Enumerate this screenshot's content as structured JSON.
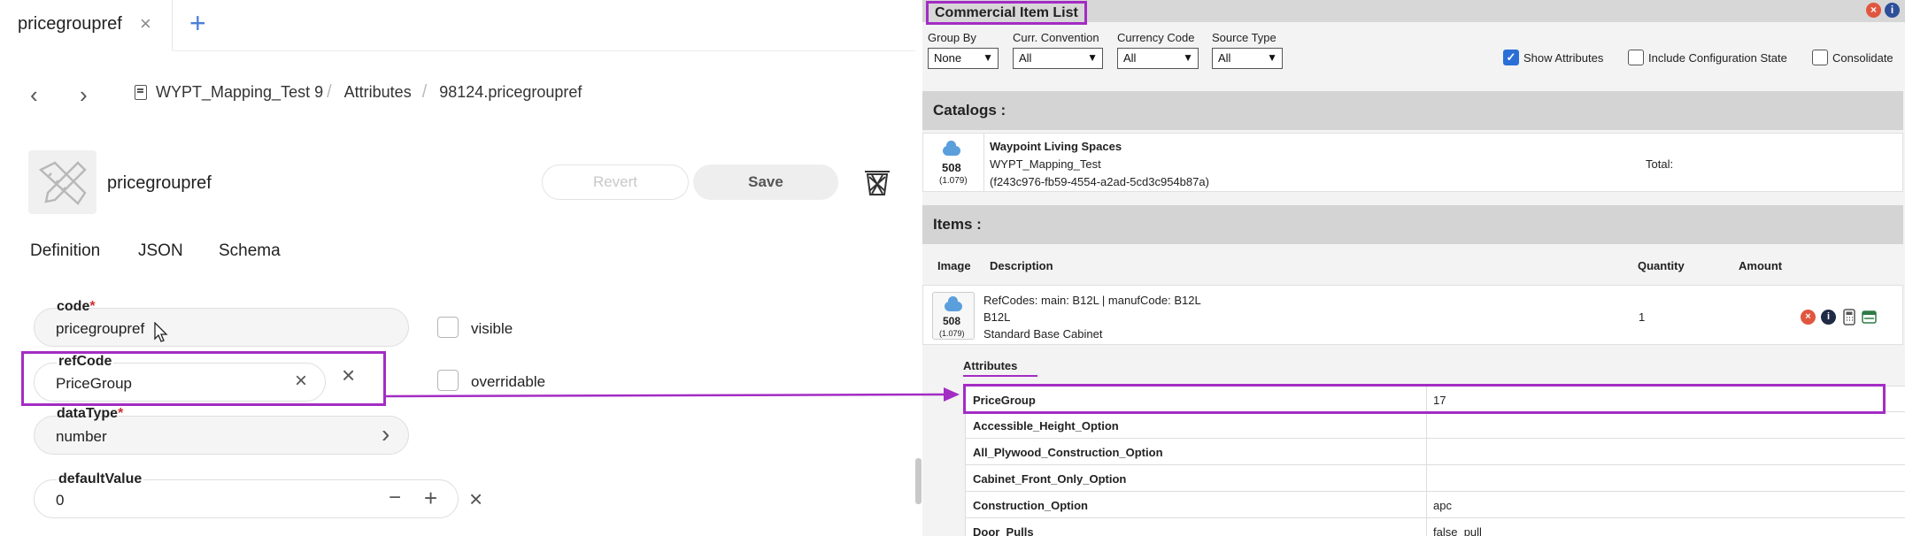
{
  "left": {
    "tab": {
      "label": "pricegroupref",
      "close": "×"
    },
    "tab_add": "+",
    "nav": {
      "back": "‹",
      "forward": "›"
    },
    "breadcrumb": [
      {
        "label": "WYPT_Mapping_Test 9"
      },
      {
        "label": "Attributes"
      },
      {
        "label": "98124.pricegroupref"
      }
    ],
    "breadcrumb_sep": "/",
    "resource_title": "pricegroupref",
    "buttons": {
      "revert": "Revert",
      "save": "Save"
    },
    "subtabs": [
      "Definition",
      "JSON",
      "Schema"
    ],
    "fields": {
      "code": {
        "label": "code",
        "required": "*",
        "value": "pricegroupref"
      },
      "refCode": {
        "label": "refCode",
        "value": "PriceGroup"
      },
      "dataType": {
        "label": "dataType",
        "required": "*",
        "value": "number"
      },
      "defaultValue": {
        "label": "defaultValue",
        "value": "0"
      }
    },
    "checkboxes": {
      "visible": "visible",
      "overridable": "overridable"
    },
    "icons": {
      "clear": "×",
      "chevron": "›",
      "minus": "−",
      "plus": "+"
    }
  },
  "right": {
    "title": "Commercial Item List",
    "filters": [
      {
        "label": "Group By",
        "value": "None"
      },
      {
        "label": "Curr. Convention",
        "value": "All"
      },
      {
        "label": "Currency Code",
        "value": "All"
      },
      {
        "label": "Source Type",
        "value": "All"
      }
    ],
    "options": [
      {
        "label": "Show Attributes",
        "checked": true
      },
      {
        "label": "Include Configuration State",
        "checked": false
      },
      {
        "label": "Consolidate",
        "checked": false
      }
    ],
    "catalogs_label": "Catalogs :",
    "catalog": {
      "count": "508",
      "sub_count": "(1.079)",
      "name": "Waypoint Living Spaces",
      "code": "WYPT_Mapping_Test",
      "guid": "(f243c976-fb59-4554-a2ad-5cd3c954b87a)",
      "total_label": "Total:"
    },
    "items_label": "Items :",
    "columns": {
      "image": "Image",
      "description": "Description",
      "quantity": "Quantity",
      "amount": "Amount"
    },
    "item": {
      "count": "508",
      "sub_count": "(1.079)",
      "refcodes": "RefCodes: main: B12L | manufCode: B12L",
      "code": "B12L",
      "name": "Standard Base Cabinet",
      "quantity": "1"
    },
    "attributes_label": "Attributes",
    "attributes": [
      {
        "name": "PriceGroup",
        "value": "17"
      },
      {
        "name": "Accessible_Height_Option",
        "value": ""
      },
      {
        "name": "All_Plywood_Construction_Option",
        "value": ""
      },
      {
        "name": "Cabinet_Front_Only_Option",
        "value": ""
      },
      {
        "name": "Construction_Option",
        "value": "apc"
      },
      {
        "name": "Door_Pulls",
        "value": "false_pull"
      }
    ]
  },
  "colors": {
    "highlight": "#a32cc4",
    "accent": "#2a6fd6",
    "danger": "#e0563f",
    "cloud": "#5a9fdc"
  }
}
